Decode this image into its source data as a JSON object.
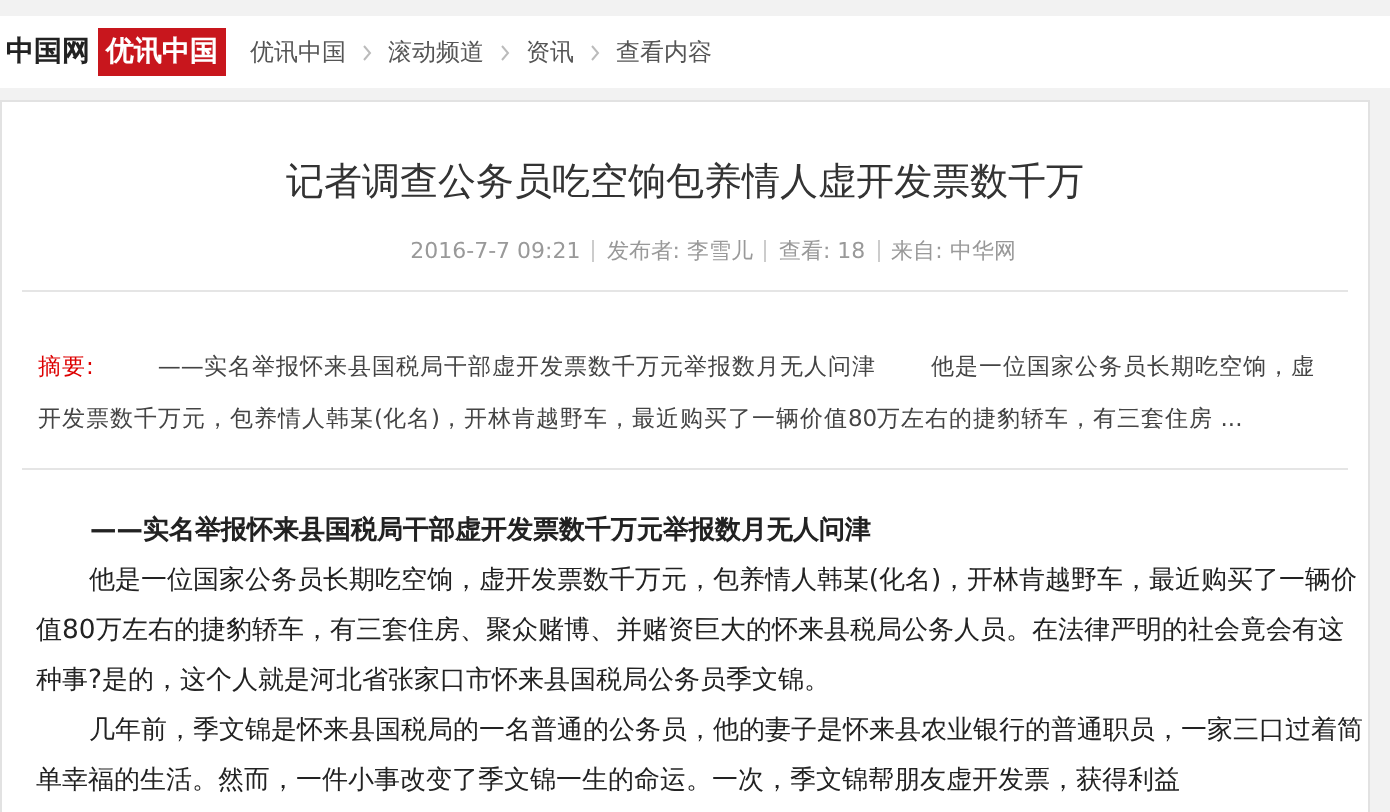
{
  "header": {
    "logo": "中国网",
    "brand": "优讯中国",
    "breadcrumbs": [
      "优讯中国",
      "滚动频道",
      "资讯",
      "查看内容"
    ]
  },
  "article": {
    "title": "记者调查公务员吃空饷包养情人虚开发票数千万",
    "meta": [
      "2016-7-7 09:21",
      "发布者: 李雪儿",
      "查看: 18",
      "来自: 中华网"
    ],
    "summary_label": "摘要:",
    "summary": "——实名举报怀来县国税局干部虚开发票数千万元举报数月无人问津　　 他是一位国家公务员长期吃空饷，虚开发票数千万元，包养情人韩某(化名)，开林肯越野车，最近购买了一辆价值80万左右的捷豹轿车，有三套住房 ...",
    "subtitle": "——实名举报怀来县国税局干部虚开发票数千万元举报数月无人问津",
    "paragraphs": [
      "他是一位国家公务员长期吃空饷，虚开发票数千万元，包养情人韩某(化名)，开林肯越野车，最近购买了一辆价值80万左右的捷豹轿车，有三套住房、聚众赌博、并赌资巨大的怀来县税局公务人员。在法律严明的社会竟会有这种事?是的，这个人就是河北省张家口市怀来县国税局公务员季文锦。",
      "几年前，季文锦是怀来县国税局的一名普通的公务员，他的妻子是怀来县农业银行的普通职员，一家三口过着简单幸福的生活。然而，一件小事改变了季文锦一生的命运。一次，季文锦帮朋友虚开发票，获得利益"
    ]
  }
}
